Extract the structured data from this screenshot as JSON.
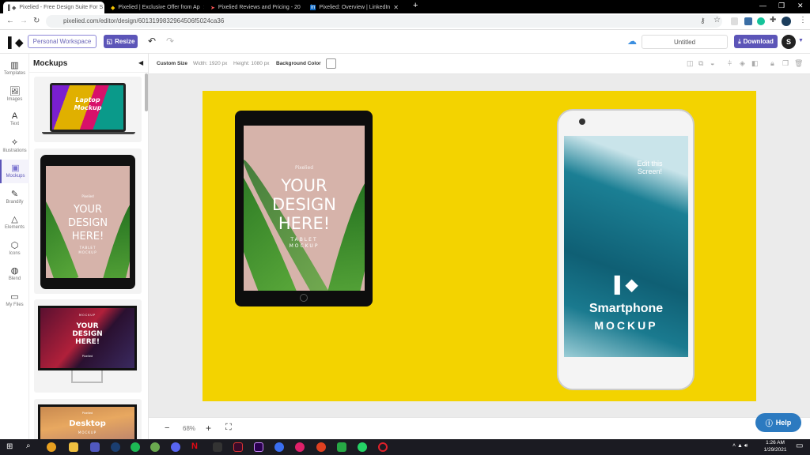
{
  "browser": {
    "tabs": [
      {
        "label": "Pixelied - Free Design Suite For S",
        "active": true
      },
      {
        "label": "Pixelied | Exclusive Offer from Ap",
        "active": false
      },
      {
        "label": "Pixelied Reviews and Pricing - 20",
        "active": false
      },
      {
        "label": "Pixelied: Overview | LinkedIn",
        "active": false
      }
    ],
    "new_tab": "+",
    "url": "pixelied.com/editor/design/6013199832964506f5024ca36"
  },
  "header": {
    "workspace": "Personal Workspace",
    "resize": "Resize",
    "title": "Untitled",
    "download": "Download",
    "avatar": "S",
    "accent": "#5c55b8"
  },
  "rail": [
    {
      "label": "Templates",
      "icon": "templates-icon",
      "glyph": "▥"
    },
    {
      "label": "Images",
      "icon": "image-icon",
      "glyph": "🖼"
    },
    {
      "label": "Text",
      "icon": "text-icon",
      "glyph": "A"
    },
    {
      "label": "Illustrations",
      "icon": "illustrations-icon",
      "glyph": "⟡"
    },
    {
      "label": "Mockups",
      "icon": "mockups-icon",
      "glyph": "▣",
      "active": true
    },
    {
      "label": "Brandify",
      "icon": "magic-wand-icon",
      "glyph": "✎"
    },
    {
      "label": "Elements",
      "icon": "shapes-icon",
      "glyph": "△"
    },
    {
      "label": "Icons",
      "icon": "cube-icon",
      "glyph": "⬡"
    },
    {
      "label": "Blend",
      "icon": "palette-icon",
      "glyph": "◍"
    },
    {
      "label": "My Files",
      "icon": "folder-icon",
      "glyph": "▭"
    }
  ],
  "panel": {
    "title": "Mockups",
    "cards": [
      {
        "line1": "Laptop",
        "line2": "Mockup"
      },
      {
        "brand": "Pixelied",
        "line1": "YOUR",
        "line2": "DESIGN",
        "line3": "HERE!",
        "sub1": "TABLET",
        "sub2": "MOCKUP"
      },
      {
        "top": "MOCKUP",
        "line1": "YOUR",
        "line2": "DESIGN",
        "line3": "HERE!",
        "brand": "Pixelied"
      },
      {
        "brand": "Pixelied",
        "line1": "Desktop",
        "sub1": "MOCKUP"
      }
    ]
  },
  "toolbar": {
    "custom_size": "Custom Size",
    "width": "Width: 1920 px",
    "height": "Height: 1080 px",
    "bg_color": "Background Color"
  },
  "canvas": {
    "background": "#f3d300",
    "tablet": {
      "brand": "Pixelied",
      "line1": "YOUR",
      "line2": "DESIGN",
      "line3": "HERE!",
      "sub1": "TABLET",
      "sub2": "MOCKUP"
    },
    "phone": {
      "edit1": "Edit this",
      "edit2": "Screen!",
      "title": "Smartphone",
      "sub": "MOCKUP"
    }
  },
  "zoom": {
    "minus": "−",
    "level": "68%",
    "plus": "+"
  },
  "help": "Help",
  "taskbar": {
    "time": "1:26 AM",
    "date": "1/29/2021"
  }
}
